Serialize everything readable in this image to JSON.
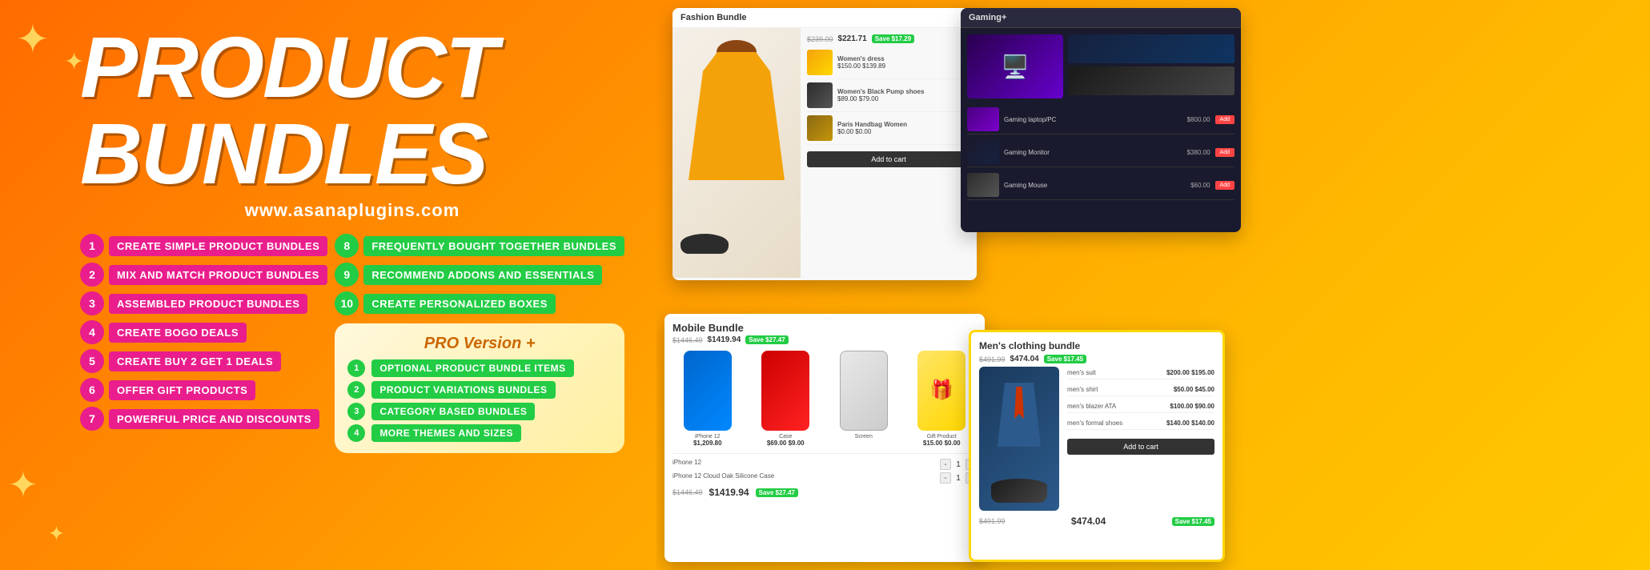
{
  "banner": {
    "title": "PRODUCT BUNDLES",
    "website": "www.asanaplugins.com",
    "background_gradient": "#FF6B00",
    "accent_pink": "#E91E8C",
    "accent_green": "#22CC44"
  },
  "features_left": [
    {
      "number": "1",
      "label": "CREATE SIMPLE PRODUCT BUNDLES"
    },
    {
      "number": "2",
      "label": "MIX AND MATCH PRODUCT BUNDLES"
    },
    {
      "number": "3",
      "label": "ASSEMBLED PRODUCT BUNDLES"
    },
    {
      "number": "4",
      "label": "CREATE BOGO DEALS"
    },
    {
      "number": "5",
      "label": "CREATE BUY 2 GET 1 DEALS"
    },
    {
      "number": "6",
      "label": "OFFER GIFT PRODUCTS"
    },
    {
      "number": "7",
      "label": "POWERFUL PRICE AND DISCOUNTS"
    }
  ],
  "features_right": [
    {
      "number": "8",
      "label": "FREQUENTLY BOUGHT TOGETHER BUNDLES"
    },
    {
      "number": "9",
      "label": "RECOMMEND ADDONS AND ESSENTIALS"
    },
    {
      "number": "10",
      "label": "CREATE PERSONALIZED BOXES"
    }
  ],
  "pro_version": {
    "title": "PRO Version +",
    "features": [
      {
        "number": "1",
        "label": "OPTIONAL PRODUCT BUNDLE ITEMS"
      },
      {
        "number": "2",
        "label": "PRODUCT VARIATIONS BUNDLES"
      },
      {
        "number": "3",
        "label": "CATEGORY BASED BUNDLES"
      },
      {
        "number": "4",
        "label": "MORE THEMES AND SIZES"
      }
    ]
  },
  "screenshots": {
    "fashion_bundle": {
      "title": "Fashion Bundle",
      "original_price": "$239.00",
      "sale_price": "$221.71",
      "badge": "Save $17.29",
      "products": [
        {
          "name": "Women's dress",
          "price": "$150.00 $139.89"
        },
        {
          "name": "Women's Black Pump shoes",
          "price": "$89.00 $79.00"
        },
        {
          "name": "Paris Handbag Women",
          "price": "$0.00 $0.00"
        }
      ]
    },
    "mobile_bundle": {
      "title": "Mobile Bundle",
      "original_price": "$1446.49",
      "sale_price": "$1419.94",
      "badge": "Save $27.47",
      "products": [
        {
          "name": "iPhone 12",
          "price": "$1,209.80"
        },
        {
          "name": "iPhone 12 Cloud Oak Silicone Case",
          "price": "$69.00 $9.00"
        },
        {
          "name": "Gift Product",
          "price": "$15.00 $0.00"
        }
      ]
    },
    "gaming_bundle": {
      "title": "Gaming+",
      "products": [
        {
          "name": "Gaming laptop/PC",
          "price": "$800.00"
        },
        {
          "name": "Gaming Monitor",
          "price": "$380.00"
        },
        {
          "name": "Gaming Mouse",
          "price": "$60.00"
        }
      ]
    },
    "mens_clothing": {
      "title": "Men's clothing bundle",
      "original_price": "$491.99",
      "sale_price": "$474.04",
      "badge": "Save $17.45",
      "products": [
        {
          "name": "men's suit",
          "price": "$200.00 $195.00"
        },
        {
          "name": "men's shirt",
          "price": "$50.00 $45.00"
        },
        {
          "name": "men's blazer ATA",
          "price": "$100.00 $90.00"
        },
        {
          "name": "men's formal shoes",
          "price": "$140.00 $140.00"
        }
      ]
    }
  }
}
